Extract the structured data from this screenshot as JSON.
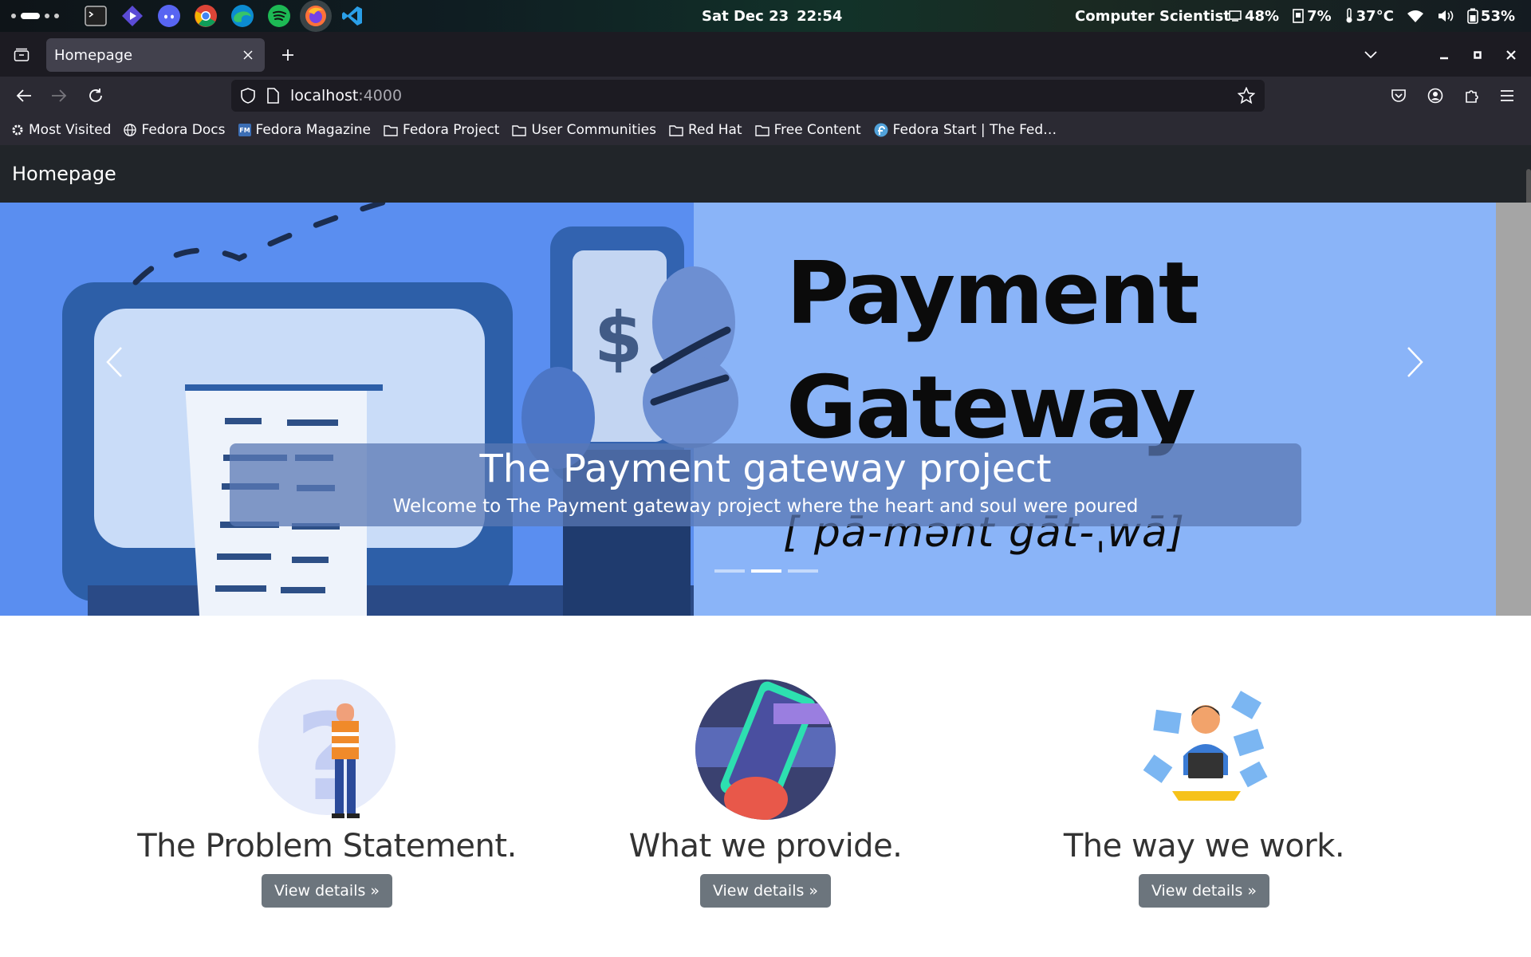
{
  "system": {
    "date": "Sat Dec 23",
    "time": "22:54",
    "user": "Computer Scientist",
    "cpu": "48%",
    "memory": "7%",
    "temperature": "37°C",
    "battery": "53%",
    "dock_icons": [
      "terminal-icon",
      "launcher-icon",
      "discord-icon",
      "chrome-icon",
      "edge-icon",
      "spotify-icon",
      "firefox-icon",
      "vscode-icon"
    ]
  },
  "browser": {
    "tab_title": "Homepage",
    "url_host": "localhost",
    "url_port": ":4000",
    "bookmarks": [
      {
        "label": "Most Visited",
        "icon": "gear-icon"
      },
      {
        "label": "Fedora Docs",
        "icon": "globe-icon"
      },
      {
        "label": "Fedora Magazine",
        "icon": "fm-icon"
      },
      {
        "label": "Fedora Project",
        "icon": "folder-icon"
      },
      {
        "label": "User Communities",
        "icon": "folder-icon"
      },
      {
        "label": "Red Hat",
        "icon": "folder-icon"
      },
      {
        "label": "Free Content",
        "icon": "folder-icon"
      },
      {
        "label": "Fedora Start | The Fed…",
        "icon": "fedora-icon"
      }
    ]
  },
  "site": {
    "brand": "Homepage",
    "carousel": {
      "image_title_line1": "Payment",
      "image_title_line2": "Gateway",
      "image_phonetic": "[ pā-mənt  gāt-ˌwā]",
      "caption_title": "The Payment gateway project",
      "caption_text": "Welcome to The Payment gateway project where the heart and soul were poured",
      "active_slide": 2,
      "slide_count": 3
    },
    "features": [
      {
        "heading": "The Problem Statement.",
        "button": "View details »"
      },
      {
        "heading": "What we provide.",
        "button": "View details »"
      },
      {
        "heading": "The way we work.",
        "button": "View details »"
      }
    ]
  },
  "colors": {
    "carousel_bg": "#8ab4f8",
    "navbar_bg": "#212529",
    "button_bg": "#6c757d",
    "caption_bg": "rgba(90,120,180,0.75)"
  }
}
